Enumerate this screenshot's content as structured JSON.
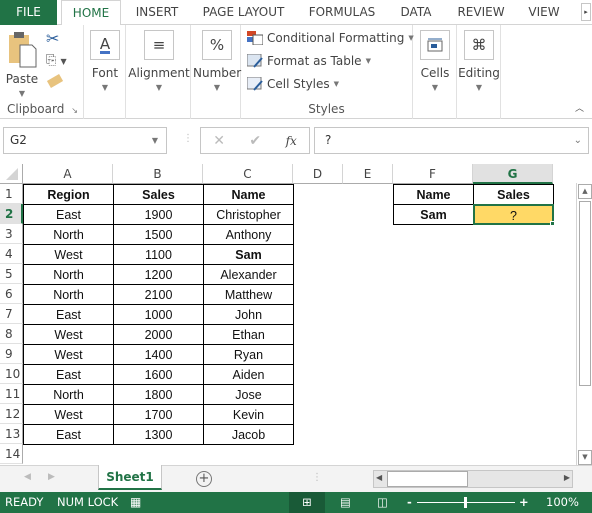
{
  "tabs": {
    "file": "FILE",
    "home": "HOME",
    "insert": "INSERT",
    "page_layout": "PAGE LAYOUT",
    "formulas": "FORMULAS",
    "data": "DATA",
    "review": "REVIEW",
    "view": "VIEW"
  },
  "ribbon": {
    "clipboard": {
      "paste": "Paste",
      "label": "Clipboard"
    },
    "font": {
      "label": "Font"
    },
    "alignment": {
      "label": "Alignment"
    },
    "number": {
      "label": "Number",
      "icon_glyph": "%"
    },
    "styles": {
      "conditional_formatting": "Conditional Formatting",
      "format_as_table": "Format as Table",
      "cell_styles": "Cell Styles",
      "label": "Styles"
    },
    "cells": {
      "label": "Cells"
    },
    "editing": {
      "label": "Editing"
    }
  },
  "formula_bar": {
    "name_box": "G2",
    "fx": "fx",
    "value": "?"
  },
  "columns": [
    "A",
    "B",
    "C",
    "D",
    "E",
    "F",
    "G"
  ],
  "selected_column": "G",
  "selected_row": 2,
  "rows": [
    "1",
    "2",
    "3",
    "4",
    "5",
    "6",
    "7",
    "8",
    "9",
    "10",
    "11",
    "12",
    "13",
    "14"
  ],
  "table": {
    "headers": [
      "Region",
      "Sales",
      "Name"
    ],
    "data": [
      [
        "East",
        "1900",
        "Christopher"
      ],
      [
        "North",
        "1500",
        "Anthony"
      ],
      [
        "West",
        "1100",
        "Sam"
      ],
      [
        "North",
        "1200",
        "Alexander"
      ],
      [
        "North",
        "2100",
        "Matthew"
      ],
      [
        "East",
        "1000",
        "John"
      ],
      [
        "West",
        "2000",
        "Ethan"
      ],
      [
        "West",
        "1400",
        "Ryan"
      ],
      [
        "East",
        "1600",
        "Aiden"
      ],
      [
        "North",
        "1800",
        "Jose"
      ],
      [
        "West",
        "1700",
        "Kevin"
      ],
      [
        "East",
        "1300",
        "Jacob"
      ]
    ]
  },
  "lookup": {
    "headers": [
      "Name",
      "Sales"
    ],
    "name": "Sam",
    "result": "?",
    "highlight_color": "#FFD966"
  },
  "sheet_tabs": [
    "Sheet1"
  ],
  "status": {
    "ready": "READY",
    "num_lock": "NUM LOCK",
    "zoom": "100%"
  },
  "colors": {
    "accent": "#217346"
  }
}
